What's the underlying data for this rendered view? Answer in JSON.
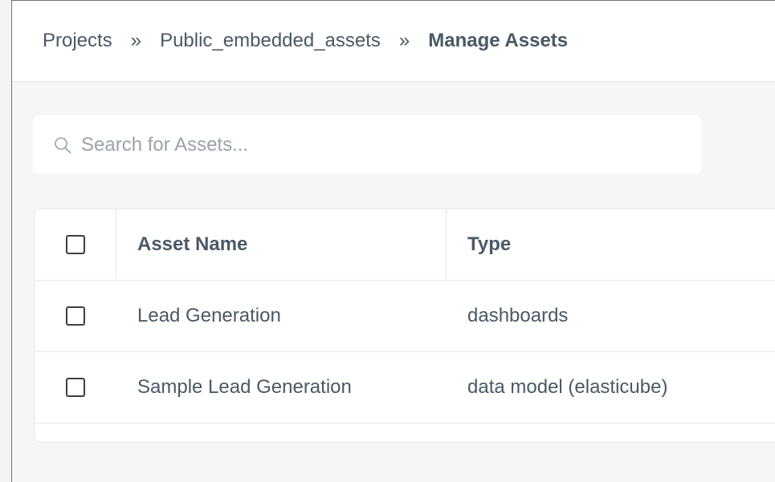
{
  "breadcrumb": {
    "items": [
      "Projects",
      "Public_embedded_assets",
      "Manage Assets"
    ],
    "separator": "»"
  },
  "search": {
    "placeholder": "Search for Assets..."
  },
  "table": {
    "columns": [
      "Asset Name",
      "Type"
    ],
    "rows": [
      {
        "name": "Lead Generation",
        "type": "dashboards"
      },
      {
        "name": "Sample Lead Generation",
        "type": "data model (elasticube)"
      }
    ]
  },
  "colors": {
    "text": "#4b5866",
    "background": "#f5f6f8",
    "card": "#ffffff",
    "border": "#e6e7ea"
  }
}
